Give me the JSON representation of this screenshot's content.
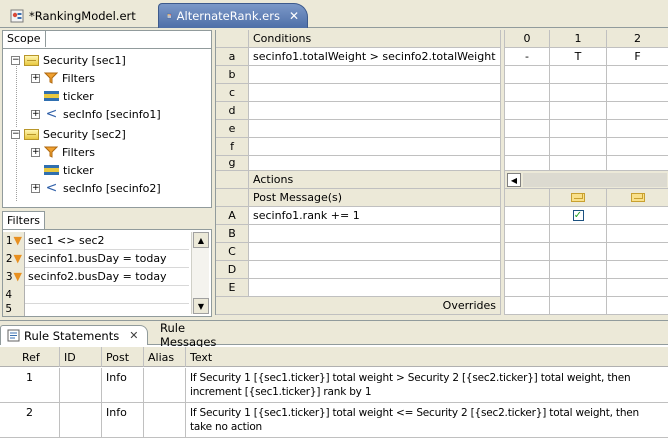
{
  "editor_tabs": [
    {
      "label": "*RankingModel.ert",
      "active": false
    },
    {
      "label": "AlternateRank.ers",
      "active": true
    }
  ],
  "scope": {
    "tab_label": "Scope",
    "tree": [
      {
        "label": "Security [sec1]",
        "icon": "security-icon",
        "level": 0,
        "expander": "minus"
      },
      {
        "label": "Filters",
        "icon": "filter-icon",
        "level": 1,
        "expander": "plus"
      },
      {
        "label": "ticker",
        "icon": "ticker-icon",
        "level": 1,
        "expander": ""
      },
      {
        "label": "secInfo [secinfo1]",
        "icon": "secinfo-icon",
        "level": 1,
        "expander": "plus"
      },
      {
        "label": "Security [sec2]",
        "icon": "security-icon",
        "level": 0,
        "expander": "minus"
      },
      {
        "label": "Filters",
        "icon": "filter-icon",
        "level": 1,
        "expander": "plus"
      },
      {
        "label": "ticker",
        "icon": "ticker-icon",
        "level": 1,
        "expander": ""
      },
      {
        "label": "secInfo [secinfo2]",
        "icon": "secinfo-icon",
        "level": 1,
        "expander": "plus"
      }
    ]
  },
  "filters": {
    "tab_label": "Filters",
    "rows": [
      {
        "num": "1",
        "text": "sec1 <> sec2"
      },
      {
        "num": "2",
        "text": "secinfo1.busDay = today"
      },
      {
        "num": "3",
        "text": "secinfo2.busDay = today"
      },
      {
        "num": "4",
        "text": ""
      },
      {
        "num": "5",
        "text": ""
      }
    ]
  },
  "grid": {
    "conditions_header": "Conditions",
    "col_headers": [
      "0",
      "1",
      "2"
    ],
    "condition_rows": [
      {
        "label": "a",
        "text": "secinfo1.totalWeight > secinfo2.totalWeight",
        "values": [
          "-",
          "T",
          "F"
        ]
      },
      {
        "label": "b",
        "text": "",
        "values": [
          "",
          "",
          ""
        ]
      },
      {
        "label": "c",
        "text": "",
        "values": [
          "",
          "",
          ""
        ]
      },
      {
        "label": "d",
        "text": "",
        "values": [
          "",
          "",
          ""
        ]
      },
      {
        "label": "e",
        "text": "",
        "values": [
          "",
          "",
          ""
        ]
      },
      {
        "label": "f",
        "text": "",
        "values": [
          "",
          "",
          ""
        ]
      },
      {
        "label": "g",
        "text": "",
        "values": [
          "",
          "",
          ""
        ]
      }
    ],
    "actions_header": "Actions",
    "post_message_label": "Post Message(s)",
    "action_rows": [
      {
        "label": "A",
        "text": "secinfo1.rank += 1",
        "checked": [
          false,
          true,
          false
        ]
      },
      {
        "label": "B",
        "text": ""
      },
      {
        "label": "C",
        "text": ""
      },
      {
        "label": "D",
        "text": ""
      },
      {
        "label": "E",
        "text": ""
      }
    ],
    "overrides_label": "Overrides"
  },
  "bottom": {
    "tabs": [
      {
        "label": "Rule Statements",
        "active": true
      },
      {
        "label": "Rule Messages",
        "active": false
      }
    ],
    "columns": [
      "Ref",
      "ID",
      "Post",
      "Alias",
      "Text"
    ],
    "rows": [
      {
        "ref": "1",
        "id": "",
        "post": "Info",
        "alias": "",
        "text": "If Security 1 [{sec1.ticker}] total weight > Security 2 [{sec2.ticker}] total weight, then increment [{sec1.ticker}] rank by 1"
      },
      {
        "ref": "2",
        "id": "",
        "post": "Info",
        "alias": "",
        "text": "If Security 1 [{sec1.ticker}] total weight <= Security 2 [{sec2.ticker}] total weight, then take no action"
      }
    ]
  },
  "colors": {
    "chrome": "#ece9d8",
    "active_tab": "#5a7bb5",
    "border": "#919b9c",
    "grid_line": "#c0c0c0"
  }
}
